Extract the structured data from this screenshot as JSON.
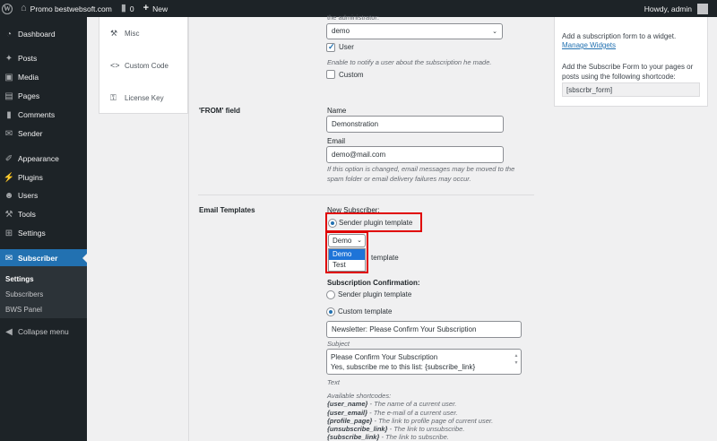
{
  "adminbar": {
    "site_name": "Promo bestwebsoft.com",
    "comments_count": "0",
    "new_label": "New",
    "howdy": "Howdy, admin"
  },
  "sidebar": {
    "items": [
      {
        "label": "Dashboard",
        "icon": "dashboard-icon"
      },
      {
        "label": "Posts",
        "icon": "pin-icon"
      },
      {
        "label": "Media",
        "icon": "media-icon"
      },
      {
        "label": "Pages",
        "icon": "pages-icon"
      },
      {
        "label": "Comments",
        "icon": "comment-icon"
      },
      {
        "label": "Sender",
        "icon": "sender-icon"
      },
      {
        "label": "Appearance",
        "icon": "brush-icon"
      },
      {
        "label": "Plugins",
        "icon": "plug-icon"
      },
      {
        "label": "Users",
        "icon": "user-icon"
      },
      {
        "label": "Tools",
        "icon": "wrench-icon"
      },
      {
        "label": "Settings",
        "icon": "settings-icon"
      },
      {
        "label": "Subscriber",
        "icon": "subscriber-icon"
      }
    ],
    "submenu": [
      "Settings",
      "Subscribers",
      "BWS Panel"
    ],
    "collapse": "Collapse menu"
  },
  "tabs": [
    {
      "label": "Misc",
      "icon": "wrench-icon"
    },
    {
      "label": "Custom Code",
      "icon": "code-icon"
    },
    {
      "label": "License Key",
      "icon": "key-icon"
    }
  ],
  "form": {
    "partial_label": "the administrator:",
    "admin_select": "demo",
    "user_checkbox_label": "User",
    "user_desc": "Enable to notify a user about the subscription he made.",
    "custom_checkbox_label": "Custom",
    "from_section": "'FROM' field",
    "name_label": "Name",
    "name_value": "Demonstration",
    "email_label": "Email",
    "email_value": "demo@mail.com",
    "from_desc_1": "If this option is changed, email messages may be moved to the",
    "from_desc_2": "spam folder or email delivery failures may occur.",
    "templates_section": "Email Templates",
    "new_subscriber_label": "New Subscriber:",
    "sender_template_label": "Sender plugin template",
    "template_select": "Demo",
    "template_options": [
      "Demo",
      "Test"
    ],
    "custom_template_partial": "template",
    "confirmation_label": "Subscription Confirmation:",
    "conf_sender_label": "Sender plugin template",
    "conf_custom_label": "Custom template",
    "subject_value": "Newsletter: Please Confirm Your Subscription",
    "subject_label": "Subject",
    "text_line_1": "Please Confirm Your Subscription",
    "text_line_2": "Yes, subscribe me to this list: {subscribe_link}",
    "text_label": "Text",
    "shortcodes_title": "Available shortcodes:",
    "shortcodes": [
      {
        "code": "{user_name}",
        "desc": " - The name of a current user."
      },
      {
        "code": "{user_email}",
        "desc": " - The e-mail of a current user."
      },
      {
        "code": "{profile_page}",
        "desc": " - The link to profile page of current user."
      },
      {
        "code": "{unsubscribe_link}",
        "desc": " - The link to unsubscribe."
      },
      {
        "code": "{subscribe_link}",
        "desc": " - The link to subscribe."
      }
    ]
  },
  "widget": {
    "text_1": "Add a subscription form to a widget.",
    "link": "Manage Widgets",
    "text_2": "Add the Subscribe Form to your pages or",
    "text_3": "posts using the following shortcode:",
    "shortcode": "[sbscrbr_form]"
  },
  "colors": {
    "accent": "#2271b1",
    "highlight": "#e00000",
    "sidebar": "#1d2327"
  }
}
